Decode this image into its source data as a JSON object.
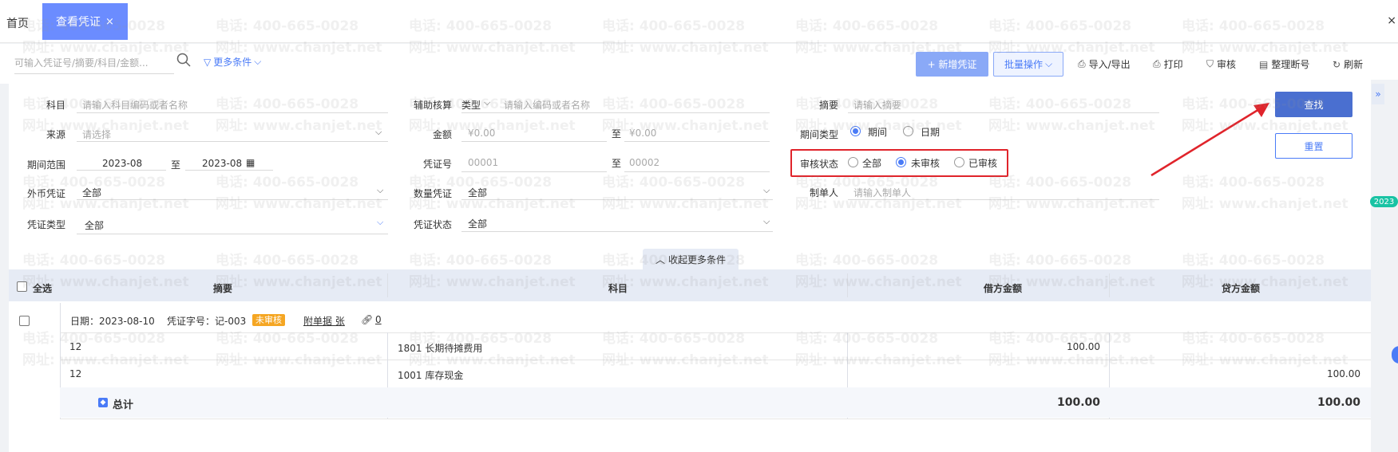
{
  "tabs": {
    "home": "首页",
    "active": "查看凭证",
    "close": "×"
  },
  "window": {
    "close": "×"
  },
  "toolbar": {
    "search_placeholder": "可输入凭证号/摘要/科目/金额...",
    "more_conditions": "更多条件",
    "new_voucher": "+ 新增凭证",
    "batch": "批量操作",
    "import_export": "导入/导出",
    "print": "打印",
    "audit": "审核",
    "renumber": "整理断号",
    "refresh": "刷新"
  },
  "filters": {
    "subject": {
      "label": "科目",
      "placeholder": "请输入科目编码或者名称"
    },
    "aux": {
      "label": "辅助核算",
      "type": "类型",
      "placeholder": "请输入编码或者名称"
    },
    "summary": {
      "label": "摘要",
      "placeholder": "请输入摘要"
    },
    "source": {
      "label": "来源",
      "placeholder": "请选择"
    },
    "amount": {
      "label": "金额",
      "from": "¥0.00",
      "to_sep": "至",
      "to": "¥0.00"
    },
    "period_type": {
      "label": "期间类型",
      "opt1": "期间",
      "opt2": "日期"
    },
    "period_range": {
      "label": "期间范围",
      "from": "2023-08",
      "sep": "至",
      "to": "2023-08"
    },
    "voucher_no": {
      "label": "凭证号",
      "from": "00001",
      "sep": "至",
      "to": "00002"
    },
    "audit_status": {
      "label": "审核状态",
      "all": "全部",
      "unaudited": "未审核",
      "audited": "已审核"
    },
    "foreign": {
      "label": "外币凭证",
      "value": "全部"
    },
    "quantity": {
      "label": "数量凭证",
      "value": "全部"
    },
    "maker": {
      "label": "制单人",
      "placeholder": "请输入制单人"
    },
    "voucher_type": {
      "label": "凭证类型",
      "value": "全部"
    },
    "voucher_status": {
      "label": "凭证状态",
      "value": "全部"
    }
  },
  "buttons": {
    "find": "查找",
    "reset": "重置",
    "collapse": "收起更多条件"
  },
  "table": {
    "headers": {
      "select_all": "全选",
      "summary": "摘要",
      "subject": "科目",
      "debit": "借方金额",
      "credit": "贷方金额"
    },
    "voucher": {
      "date": "日期：2023-08-10",
      "number": "凭证字号：记-003",
      "status": "未审核",
      "attachment": "附单据 张",
      "link_count": "0"
    },
    "rows": [
      {
        "summary": "12",
        "subject": "1801 长期待摊费用",
        "debit": "100.00",
        "credit": ""
      },
      {
        "summary": "12",
        "subject": "1001 库存现金",
        "debit": "",
        "credit": "100.00"
      }
    ],
    "total": {
      "label": "总计",
      "debit": "100.00",
      "credit": "100.00"
    }
  },
  "watermark": {
    "phone": "电话: 400-665-0028",
    "site": "网址: www.chanjet.net"
  },
  "side": {
    "year": "2023",
    "expand": "»"
  },
  "colors": {
    "accent": "#4a7bf7",
    "highlight": "#e0242b",
    "badge": "#f5a623"
  }
}
